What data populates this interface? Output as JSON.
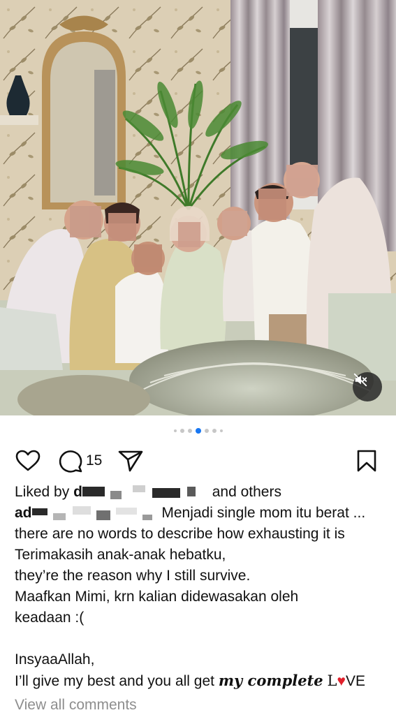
{
  "post": {
    "carousel": {
      "count": 7,
      "active_index": 3
    },
    "comment_count": "15",
    "likes": {
      "prefix": "Liked by",
      "name_start": "d",
      "suffix": "and others"
    },
    "caption": {
      "handle_start": "ad",
      "first_line_text": "Menjadi single mom itu berat ...",
      "lines": [
        "there are no words to describe how exhausting it is",
        "Terimakasih anak-anak hebatku,",
        "they’re the reason why I still survive.",
        "Maafkan Mimi, krn kalian didewasakan oleh",
        "keadaan :("
      ],
      "insya": "InsyaaAllah,",
      "last_line_start": "I’ll give my best and you all get",
      "last_line_styled": "my complete",
      "love_l": "L",
      "love_heart": "♥",
      "love_ve": "VE"
    },
    "view_all_comments": "View all comments"
  },
  "icons": {
    "like": "heart-outline-icon",
    "comment": "speech-bubble-icon",
    "share": "paper-plane-icon",
    "save": "bookmark-icon",
    "mute": "speaker-muted-icon"
  },
  "colors": {
    "active_dot": "#1877f2",
    "heart": "#e0202b",
    "muted_text": "#8e8e8e"
  }
}
